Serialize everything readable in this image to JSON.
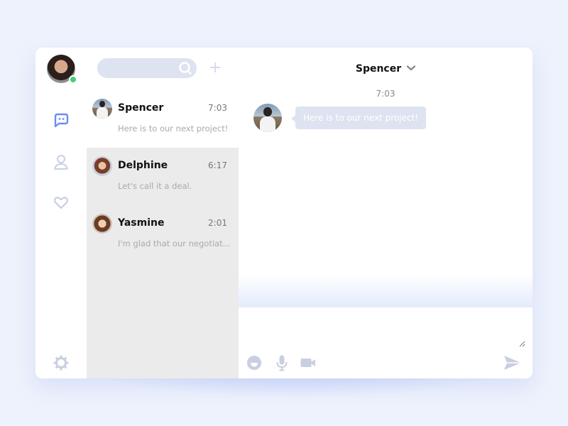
{
  "user": {
    "avatar": "user-avatar",
    "status": "online",
    "status_color": "#3fd07a"
  },
  "rail": {
    "items": [
      {
        "name": "messages",
        "icon": "chat-bubble-icon",
        "active": true
      },
      {
        "name": "contacts",
        "icon": "person-icon",
        "active": false
      },
      {
        "name": "favorites",
        "icon": "heart-icon",
        "active": false
      }
    ],
    "settings_icon": "gear-icon"
  },
  "search": {
    "placeholder": "",
    "value": ""
  },
  "new_chat_label": "+",
  "conversations": [
    {
      "name": "Spencer",
      "time": "7:03",
      "preview": "Here is to our next project!",
      "selected": true
    },
    {
      "name": "Delphine",
      "time": "6:17",
      "preview": "Let's call it a deal.",
      "selected": false
    },
    {
      "name": "Yasmine",
      "time": "2:01",
      "preview": "I'm glad that our negotiat...",
      "selected": false
    }
  ],
  "chat": {
    "title": "Spencer",
    "chevron": "❯",
    "messages": [
      {
        "time": "7:03",
        "from": "Spencer",
        "text": "Here is to our next project!"
      }
    ]
  },
  "composer": {
    "placeholder": "",
    "value": ""
  },
  "colors": {
    "accent": "#6e8cf0",
    "icon_muted": "#c9cfe3",
    "bubble": "#dde3f0",
    "list_bg": "#ebebeb"
  }
}
